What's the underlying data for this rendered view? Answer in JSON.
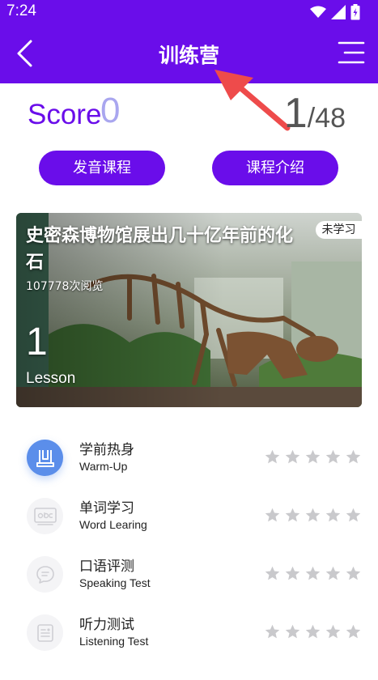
{
  "status_bar": {
    "time": "7:24"
  },
  "header": {
    "title": "训练营"
  },
  "score": {
    "label": "Score",
    "value": "0"
  },
  "progress": {
    "current": "1",
    "separator": "/",
    "total": "48"
  },
  "buttons": {
    "pronunciation_course": "发音课程",
    "course_intro": "课程介绍"
  },
  "lesson": {
    "title": "史密森博物馆展出几十亿年前的化石",
    "views": "107778次阅览",
    "status": "未学习",
    "number": "1",
    "number_label": "Lesson"
  },
  "activities": [
    {
      "title": "学前热身",
      "subtitle": "Warm-Up",
      "icon": "warm-up-icon",
      "stars": 0
    },
    {
      "title": "单词学习",
      "subtitle": "Word Learing",
      "icon": "word-card-icon",
      "stars": 0
    },
    {
      "title": "口语评测",
      "subtitle": "Speaking Test",
      "icon": "speech-bubble-icon",
      "stars": 0
    },
    {
      "title": "听力测试",
      "subtitle": "Listening Test",
      "icon": "listening-doc-icon",
      "stars": 0
    }
  ],
  "colors": {
    "brand": "#6a0dea",
    "score_value": "#a9a6ef",
    "active_icon": "#5b8eea",
    "star_empty": "#c9c9cc",
    "annotation_arrow": "#ee4b4b"
  }
}
